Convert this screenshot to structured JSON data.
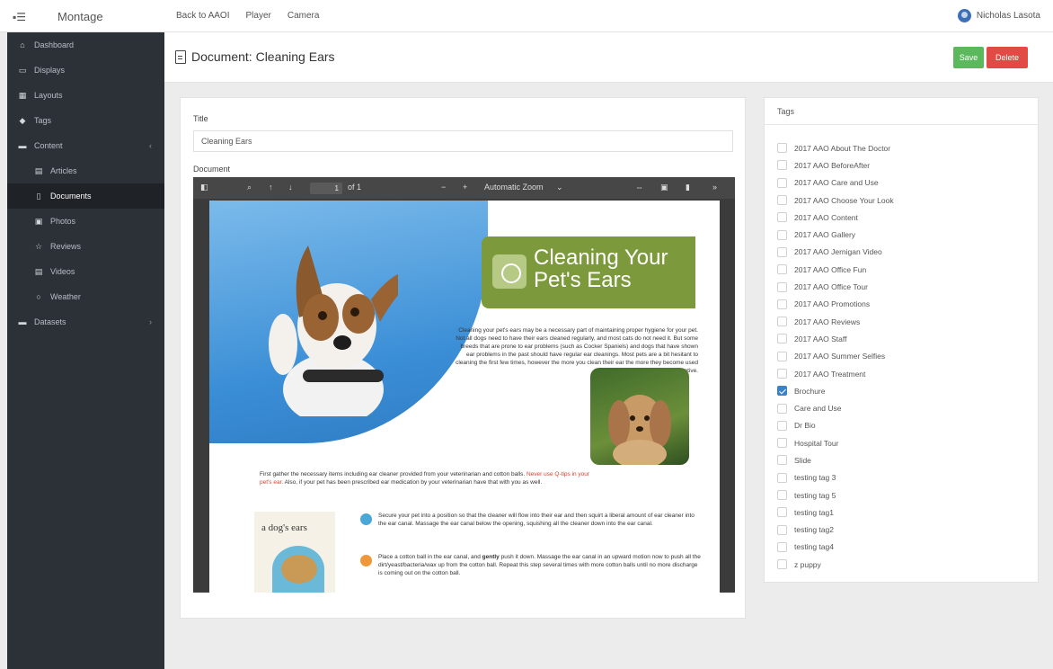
{
  "topbar": {
    "brand": "Montage",
    "nav": [
      "Back to AAOI",
      "Player",
      "Camera"
    ],
    "user": "Nicholas Lasota"
  },
  "sidebar": {
    "items": [
      {
        "label": "Dashboard",
        "icon": "dashboard-icon",
        "glyph": "⌂"
      },
      {
        "label": "Displays",
        "icon": "monitor-icon",
        "glyph": "▭"
      },
      {
        "label": "Layouts",
        "icon": "grid-icon",
        "glyph": "▦"
      },
      {
        "label": "Tags",
        "icon": "tag-icon",
        "glyph": "◆"
      },
      {
        "label": "Content",
        "icon": "folder-icon",
        "glyph": "▬",
        "chevron": "‹"
      },
      {
        "label": "Articles",
        "icon": "article-icon",
        "glyph": "▤",
        "sub": true
      },
      {
        "label": "Documents",
        "icon": "document-icon",
        "glyph": "▯",
        "sub": true,
        "active": true
      },
      {
        "label": "Photos",
        "icon": "photo-icon",
        "glyph": "▣",
        "sub": true
      },
      {
        "label": "Reviews",
        "icon": "star-icon",
        "glyph": "☆",
        "sub": true
      },
      {
        "label": "Videos",
        "icon": "video-icon",
        "glyph": "▤",
        "sub": true
      },
      {
        "label": "Weather",
        "icon": "weather-icon",
        "glyph": "○",
        "sub": true
      },
      {
        "label": "Datasets",
        "icon": "dataset-icon",
        "glyph": "▬",
        "chevron": "›"
      }
    ]
  },
  "header": {
    "title": "Document: Cleaning Ears",
    "save_label": "Save",
    "delete_label": "Delete"
  },
  "form": {
    "title_label": "Title",
    "title_value": "Cleaning Ears",
    "document_label": "Document"
  },
  "viewer": {
    "page_current": "1",
    "page_total": "of 1",
    "zoom": "Automatic Zoom",
    "zoom_caret": "⌄",
    "minus": "−",
    "plus": "+",
    "more": "»",
    "pdf": {
      "banner": "Cleaning Your Pet's Ears",
      "intro": "Cleaning your pet's ears may be a necessary part of maintaining proper hygiene for your pet. Not all dogs need to have their ears cleaned regularly, and most cats do not need it. But some breeds that are prone to ear problems (such as Cocker Spaniels) and dogs that have shown ear problems in the past should have regular ear cleanings. Most pets are a bit hesitant to cleaning the first few times, however the more you clean their ear the more they become used to it and more cooperative.",
      "gather_before": "First gather the necessary items including ear cleaner provided from your veterinarian and cotton balls.",
      "gather_red": "Never use Q-tips in your pet's ear.",
      "gather_after": "Also, if your pet has been prescribed ear medication by your veterinarian have that with you as well.",
      "booklet_title": "a dog's ears",
      "step1": "Secure your pet into a position so that the cleaner will flow into their ear and then squirt a liberal amount of ear cleaner into the ear canal. Massage the ear canal below the opening, squishing all the cleaner down into the ear canal.",
      "step2_before": "Place a cotton ball in the ear canal, and",
      "step2_bold": "gently",
      "step2_after": "push it down. Massage the ear canal in an upward motion now to push all the dirt/yeast/bacteria/wax up from the cotton ball. Repeat this step several times with more cotton balls until no more discharge is coming out on the cotton ball."
    }
  },
  "tags": {
    "heading": "Tags",
    "items": [
      {
        "label": "2017 AAO About The Doctor",
        "checked": false
      },
      {
        "label": "2017 AAO BeforeAfter",
        "checked": false
      },
      {
        "label": "2017 AAO Care and Use",
        "checked": false
      },
      {
        "label": "2017 AAO Choose Your Look",
        "checked": false
      },
      {
        "label": "2017 AAO Content",
        "checked": false
      },
      {
        "label": "2017 AAO Gallery",
        "checked": false
      },
      {
        "label": "2017 AAO Jernigan Video",
        "checked": false
      },
      {
        "label": "2017 AAO Office Fun",
        "checked": false
      },
      {
        "label": "2017 AAO Office Tour",
        "checked": false
      },
      {
        "label": "2017 AAO Promotions",
        "checked": false
      },
      {
        "label": "2017 AAO Reviews",
        "checked": false
      },
      {
        "label": "2017 AAO Staff",
        "checked": false
      },
      {
        "label": "2017 AAO Summer Selfies",
        "checked": false
      },
      {
        "label": "2017 AAO Treatment",
        "checked": false
      },
      {
        "label": "Brochure",
        "checked": true
      },
      {
        "label": "Care and Use",
        "checked": false
      },
      {
        "label": "Dr Bio",
        "checked": false
      },
      {
        "label": "Hospital Tour",
        "checked": false
      },
      {
        "label": "Slide",
        "checked": false
      },
      {
        "label": "testing tag 3",
        "checked": false
      },
      {
        "label": "testing tag 5",
        "checked": false
      },
      {
        "label": "testing tag1",
        "checked": false
      },
      {
        "label": "testing tag2",
        "checked": false
      },
      {
        "label": "testing tag4",
        "checked": false
      },
      {
        "label": "z puppy",
        "checked": false
      }
    ]
  },
  "colors": {
    "sidebar_bg": "#2c3138",
    "save_green": "#5cb85c",
    "delete_red": "#e24b45",
    "banner_green": "#7c9a3c",
    "checkbox_blue": "#3b82c9"
  }
}
